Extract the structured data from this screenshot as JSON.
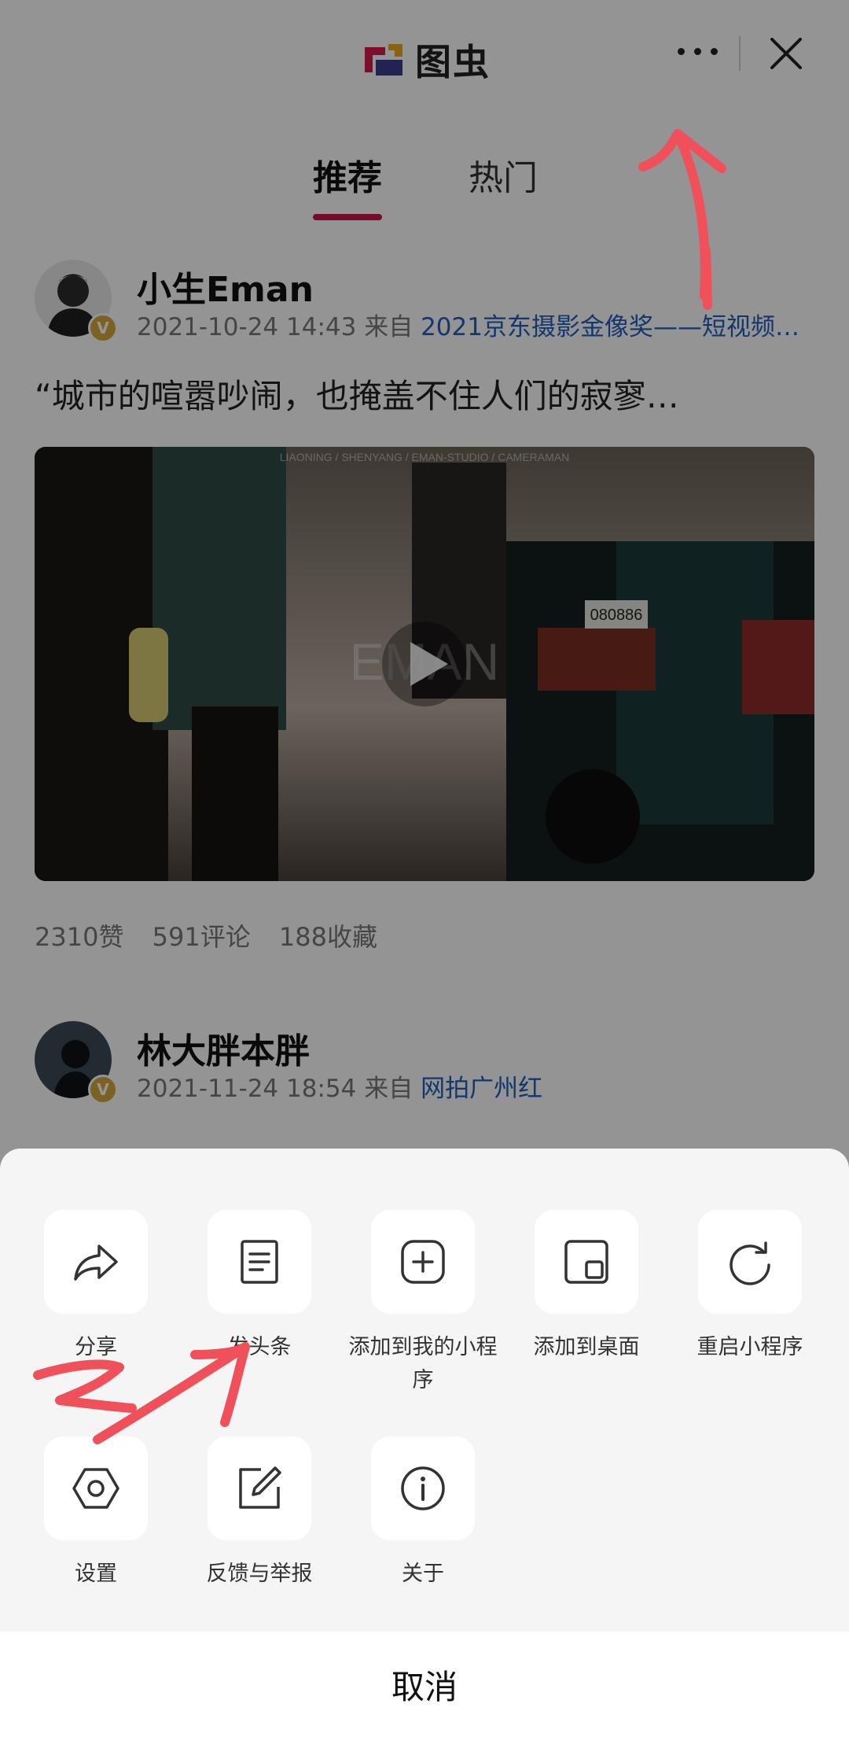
{
  "header": {
    "logo_text": "图虫",
    "tabs": [
      {
        "label": "推荐",
        "active": true
      },
      {
        "label": "热门",
        "active": false
      }
    ]
  },
  "posts": [
    {
      "user": "小生Eman",
      "badge": "V",
      "time": "2021-10-24 14:43",
      "from_label": "来自",
      "source": "2021京东摄影金像奖——短视频…",
      "text": "“城市的喧嚣吵闹，也掩盖不住人们的寂寥…",
      "video_overlay_top": "LIAONING  /  SHENYANG  /  EMAN-STUDIO  /  CAMERAMAN",
      "video_watermark": "EMAN",
      "plate": "080886",
      "stats": {
        "likes": "2310赞",
        "comments": "591评论",
        "favorites": "188收藏"
      }
    },
    {
      "user": "林大胖本胖",
      "badge": "V",
      "time": "2021-11-24 18:54",
      "from_label": "来自",
      "source": "网拍广州红"
    }
  ],
  "sheet": {
    "row1": [
      {
        "label": "分享",
        "icon": "share-icon"
      },
      {
        "label": "发头条",
        "icon": "article-icon"
      },
      {
        "label": "添加到我的小程序",
        "icon": "add-square-icon"
      },
      {
        "label": "添加到桌面",
        "icon": "add-desktop-icon"
      },
      {
        "label": "重启小程序",
        "icon": "restart-icon"
      }
    ],
    "row2": [
      {
        "label": "设置",
        "icon": "settings-hex-icon"
      },
      {
        "label": "反馈与举报",
        "icon": "feedback-edit-icon"
      },
      {
        "label": "关于",
        "icon": "info-icon"
      }
    ],
    "cancel": "取消"
  },
  "annotations": {
    "marks": [
      "2"
    ],
    "color": "#f0505a"
  },
  "colors": {
    "accent": "#c8184d",
    "link": "#1f5fbf",
    "badge": "#d6a93b"
  }
}
